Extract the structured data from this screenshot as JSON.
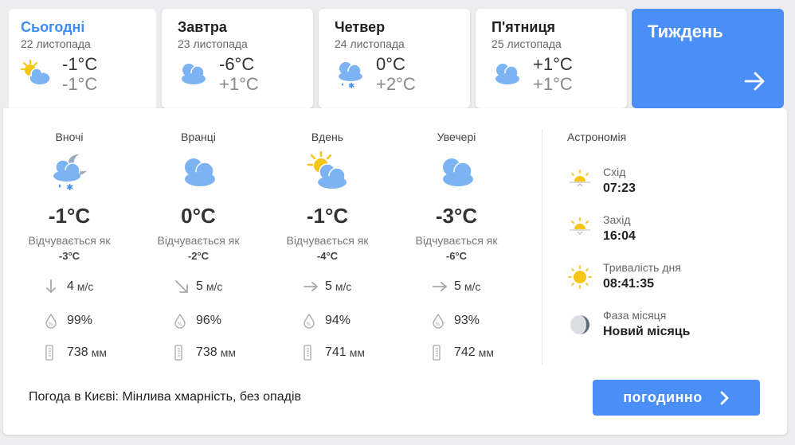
{
  "tabs": [
    {
      "day": "Сьогодні",
      "date": "22 листопада",
      "min": "-1°C",
      "max": "-1°C",
      "icon": "partly-cloudy-icon",
      "active": true
    },
    {
      "day": "Завтра",
      "date": "23 листопада",
      "min": "-6°C",
      "max": "+1°C",
      "icon": "cloudy-icon",
      "active": false
    },
    {
      "day": "Четвер",
      "date": "24 листопада",
      "min": "0°C",
      "max": "+2°C",
      "icon": "sleet-icon",
      "active": false
    },
    {
      "day": "П'ятниця",
      "date": "25 листопада",
      "min": "+1°C",
      "max": "+1°C",
      "icon": "cloudy-icon",
      "active": false
    }
  ],
  "week": {
    "label": "Тиждень"
  },
  "periods": [
    {
      "name": "Вночі",
      "icon": "night-sleet-icon",
      "temp": "-1°C",
      "feels_label": "Відчувається як",
      "feels": "-3°C",
      "wind": "4",
      "wind_unit": "м/с",
      "wind_dir": "north",
      "humidity": "99%",
      "pressure": "738",
      "pressure_unit": "мм"
    },
    {
      "name": "Вранці",
      "icon": "cloudy-icon",
      "temp": "0°C",
      "feels_label": "Відчувається як",
      "feels": "-2°C",
      "wind": "5",
      "wind_unit": "м/с",
      "wind_dir": "north-west",
      "humidity": "96%",
      "pressure": "738",
      "pressure_unit": "мм"
    },
    {
      "name": "Вдень",
      "icon": "partly-cloudy-icon",
      "temp": "-1°C",
      "feels_label": "Відчувається як",
      "feels": "-4°C",
      "wind": "5",
      "wind_unit": "м/с",
      "wind_dir": "west",
      "humidity": "94%",
      "pressure": "741",
      "pressure_unit": "мм"
    },
    {
      "name": "Увечері",
      "icon": "cloudy-icon",
      "temp": "-3°C",
      "feels_label": "Відчувається як",
      "feels": "-6°C",
      "wind": "5",
      "wind_unit": "м/с",
      "wind_dir": "west",
      "humidity": "93%",
      "pressure": "742",
      "pressure_unit": "мм"
    }
  ],
  "astronomy": {
    "title": "Астрономія",
    "sunrise_label": "Схід",
    "sunrise": "07:23",
    "sunset_label": "Захід",
    "sunset": "16:04",
    "daylength_label": "Тривалість дня",
    "daylength": "08:41:35",
    "moon_label": "Фаза місяця",
    "moon": "Новий місяць"
  },
  "summary": {
    "label": "Погода в Києві:",
    "text": "Мінлива хмарність, без опадів"
  },
  "hourly_button": "погодинно",
  "colors": {
    "accent": "#4a8ef7",
    "cloud": "#7cb3f2",
    "sun": "#f5c518"
  }
}
